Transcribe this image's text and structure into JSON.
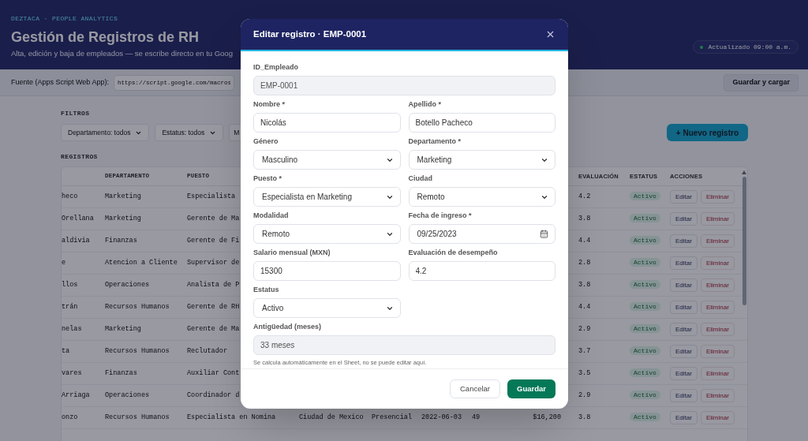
{
  "header": {
    "eyebrow": "DEZTACA · PEOPLE ANALYTICS",
    "title": "Gestión de Registros de RH",
    "subtitle": "Alta, edición y baja de empleados — se escribe directo en tu Goog",
    "status": "Actualizado 09:00 a.m."
  },
  "source": {
    "label": "Fuente (Apps Script Web App):",
    "value": "https://script.google.com/macros",
    "button": "Guardar y cargar"
  },
  "filters": {
    "title": "FILTROS",
    "selects": [
      "Departamento: todos",
      "Estatus: todos",
      "M"
    ],
    "new_button": "+ Nuevo registro"
  },
  "table": {
    "title": "REGISTROS",
    "columns_left": [
      "DEPARTAMENTO",
      "PUESTO"
    ],
    "columns_right": [
      "EVALUACIÓN",
      "ESTATUS",
      "ACCIONES"
    ],
    "rows": [
      {
        "cells": [
          "heco",
          "Marketing",
          "Especialista"
        ],
        "evaluation": "4.2",
        "status": "Activo",
        "actions": [
          "Editar",
          "Eliminar"
        ]
      },
      {
        "cells": [
          "Orellana",
          "Marketing",
          "Gerente de Ma"
        ],
        "evaluation": "3.8",
        "status": "Activo",
        "actions": [
          "Editar",
          "Eliminar"
        ]
      },
      {
        "cells": [
          "aldivia",
          "Finanzas",
          "Gerente de Fi"
        ],
        "evaluation": "4.4",
        "status": "Activo",
        "actions": [
          "Editar",
          "Eliminar"
        ]
      },
      {
        "cells": [
          "e",
          "Atencion a Cliente",
          "Supervisor de"
        ],
        "evaluation": "2.8",
        "status": "Activo",
        "actions": [
          "Editar",
          "Eliminar"
        ]
      },
      {
        "cells": [
          "llos",
          "Operaciones",
          "Analista de P"
        ],
        "evaluation": "3.8",
        "status": "Activo",
        "actions": [
          "Editar",
          "Eliminar"
        ]
      },
      {
        "cells": [
          "trán",
          "Recursos Humanos",
          "Gerente de RH"
        ],
        "evaluation": "4.4",
        "status": "Activo",
        "actions": [
          "Editar",
          "Eliminar"
        ]
      },
      {
        "cells": [
          "nelas",
          "Marketing",
          "Gerente de Ma"
        ],
        "evaluation": "2.9",
        "status": "Activo",
        "actions": [
          "Editar",
          "Eliminar"
        ]
      },
      {
        "cells": [
          "ta",
          "Recursos Humanos",
          "Reclutador"
        ],
        "evaluation": "3.7",
        "status": "Activo",
        "actions": [
          "Editar",
          "Eliminar"
        ]
      },
      {
        "cells": [
          "vares",
          "Finanzas",
          "Auxiliar Cont"
        ],
        "evaluation": "3.5",
        "status": "Activo",
        "actions": [
          "Editar",
          "Eliminar"
        ]
      },
      {
        "cells": [
          "Arriaga",
          "Operaciones",
          "Coordinador d"
        ],
        "evaluation": "2.9",
        "status": "Activo",
        "actions": [
          "Editar",
          "Eliminar"
        ]
      },
      {
        "cells": [
          "onzo",
          "Recursos Humanos",
          "Especialista en Nomina",
          "Ciudad de Mexico",
          "Presencial",
          "2022-06-03",
          "49",
          "$16,200"
        ],
        "evaluation": "3.8",
        "status": "Activo",
        "actions": [
          "Editar",
          "Eliminar"
        ]
      }
    ]
  },
  "modal": {
    "title": "Editar registro · EMP-0001",
    "fields": [
      {
        "kind": "readonly",
        "label": "ID_Empleado",
        "value": "EMP-0001"
      },
      {
        "kind": "text",
        "label": "Nombre *",
        "value": "Nicolás"
      },
      {
        "kind": "text",
        "label": "Apellido *",
        "value": "Botello Pacheco"
      },
      {
        "kind": "select",
        "label": "Género",
        "value": "Masculino"
      },
      {
        "kind": "select",
        "label": "Departamento *",
        "value": "Marketing"
      },
      {
        "kind": "select",
        "label": "Puesto *",
        "value": "Especialista en Marketing"
      },
      {
        "kind": "select",
        "label": "Ciudad",
        "value": "Remoto"
      },
      {
        "kind": "select",
        "label": "Modalidad",
        "value": "Remoto"
      },
      {
        "kind": "date",
        "label": "Fecha de ingreso *",
        "value": "09/25/2023"
      },
      {
        "kind": "text",
        "label": "Salario mensual (MXN)",
        "value": "15300"
      },
      {
        "kind": "text",
        "label": "Evaluación de desempeño",
        "value": "4.2"
      },
      {
        "kind": "select",
        "label": "Estatus",
        "value": "Activo"
      },
      {
        "kind": "readonly",
        "label": "Antigüedad (meses)",
        "value": "33 meses",
        "hint": "Se calcula automáticamente en el Sheet, no se puede editar aquí."
      }
    ],
    "buttons": [
      "Cancelar",
      "Guardar"
    ]
  }
}
